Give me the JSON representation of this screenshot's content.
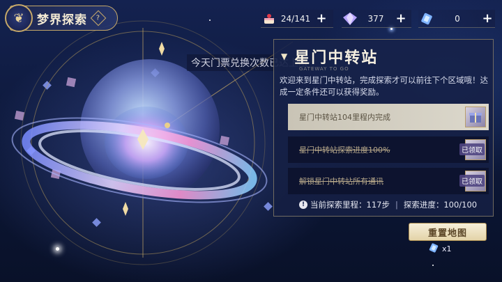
{
  "header": {
    "title": "梦界探索",
    "info_icon": "diamond-info-icon"
  },
  "resources": [
    {
      "icon": "cake-icon",
      "value": "24/141"
    },
    {
      "icon": "crystal-icon",
      "value": "377"
    },
    {
      "icon": "ticket-icon",
      "value": "0"
    }
  ],
  "notice": "今天门票兑换次数已达上限",
  "panel": {
    "title": "星门中转站",
    "subtitle": "GATEWAY TO GO",
    "description": "欢迎来到星门中转站，完成探索才可以前往下个区域哦！达成一定条件还可以获得奖励。",
    "tasks": [
      {
        "label": "星门中转站104里程内完成",
        "status": "active",
        "reward_icon": "gift-box-icon"
      },
      {
        "label": "星门中转站探索进度100%",
        "status": "claimed",
        "claimed_label": "已领取"
      },
      {
        "label": "解锁星门中转站所有通讯",
        "status": "claimed",
        "claimed_label": "已领取"
      }
    ],
    "progress": {
      "mileage_label": "当前探索里程：",
      "mileage_value": "117步",
      "separator": "|",
      "progress_label": "探索进度：",
      "progress_value": "100/100"
    }
  },
  "reset": {
    "label": "重置地图",
    "cost": "x1"
  },
  "colors": {
    "gold": "#c6a869",
    "panel_bg": "#16224a",
    "active_task": "#d3cfc2"
  }
}
